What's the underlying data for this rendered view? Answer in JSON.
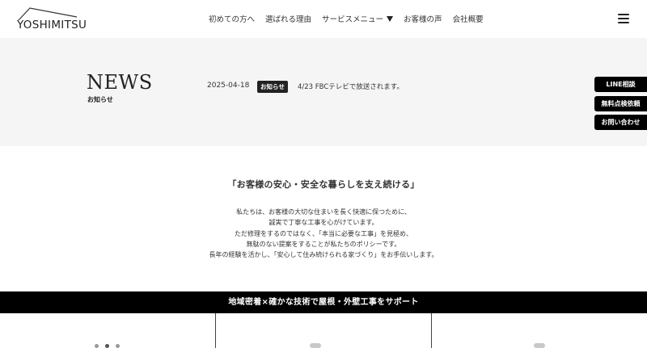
{
  "header": {
    "logo_text": "YOSHIMITSU",
    "nav": [
      {
        "label": "初めての方へ"
      },
      {
        "label": "選ばれる理由"
      },
      {
        "label": "サービスメニュー"
      },
      {
        "label": "お客様の声"
      },
      {
        "label": "会社概要"
      }
    ]
  },
  "news": {
    "title": "NEWS",
    "subtitle": "お知らせ",
    "date": "2025-04-18",
    "badge": "お知らせ",
    "text": "4/23 FBCテレビで放送されます。"
  },
  "side_buttons": {
    "line": "LINE相談",
    "inspection": "無料点検依頼",
    "contact": "お問い合わせ"
  },
  "intro": {
    "heading": "「お客様の安心・安全な暮らしを支え続ける」",
    "lines": [
      "私たちは、お客様の大切な住まいを長く快適に保つために、",
      "誠実で丁寧な工事を心がけています。",
      "ただ修理をするのではなく、「本当に必要な工事」を見極め、",
      "無駄のない提案をすることが私たちのポリシーです。",
      "長年の経験を活かし、「安心して住み続けられる家づくり」をお手伝いします。"
    ]
  },
  "banner": {
    "text": "地域密着×確かな技術で屋根・外壁工事をサポート"
  }
}
